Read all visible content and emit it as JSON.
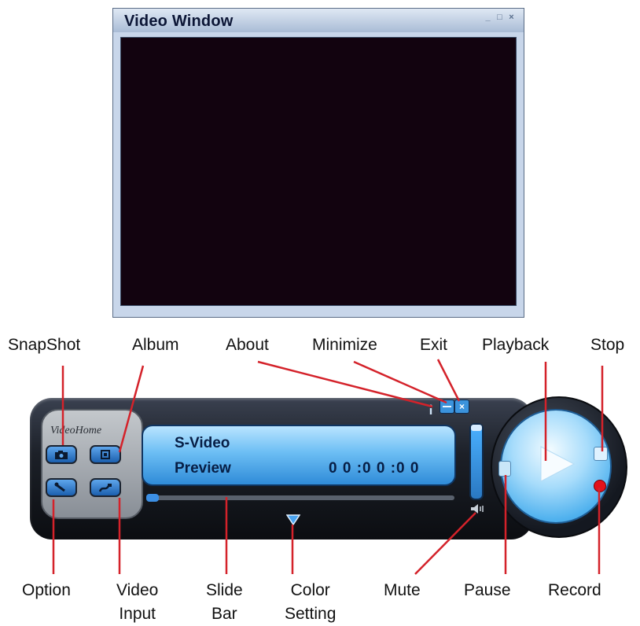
{
  "video_window": {
    "title": "Video Window",
    "controls": {
      "minimize": "_",
      "maximize": "□",
      "close": "×"
    }
  },
  "player": {
    "brand": "VideoHome",
    "display": {
      "line1": "S-Video",
      "line2": "Preview",
      "timecode": "0 0 :0 0 :0 0"
    },
    "exit_glyph": "×"
  },
  "labels": {
    "snapshot": "SnapShot",
    "album": "Album",
    "about": "About",
    "minimize": "Minimize",
    "exit": "Exit",
    "playback": "Playback",
    "stop": "Stop",
    "option": "Option",
    "video_input": [
      "Video",
      "Input"
    ],
    "slide_bar": [
      "Slide",
      "Bar"
    ],
    "color_setting": [
      "Color",
      "Setting"
    ],
    "mute": "Mute",
    "pause": "Pause",
    "record": "Record"
  },
  "colors": {
    "screen": "#12030f",
    "display_blue": "#6cbef4",
    "leader_red": "#d4222a",
    "record_red": "#e3111a"
  }
}
